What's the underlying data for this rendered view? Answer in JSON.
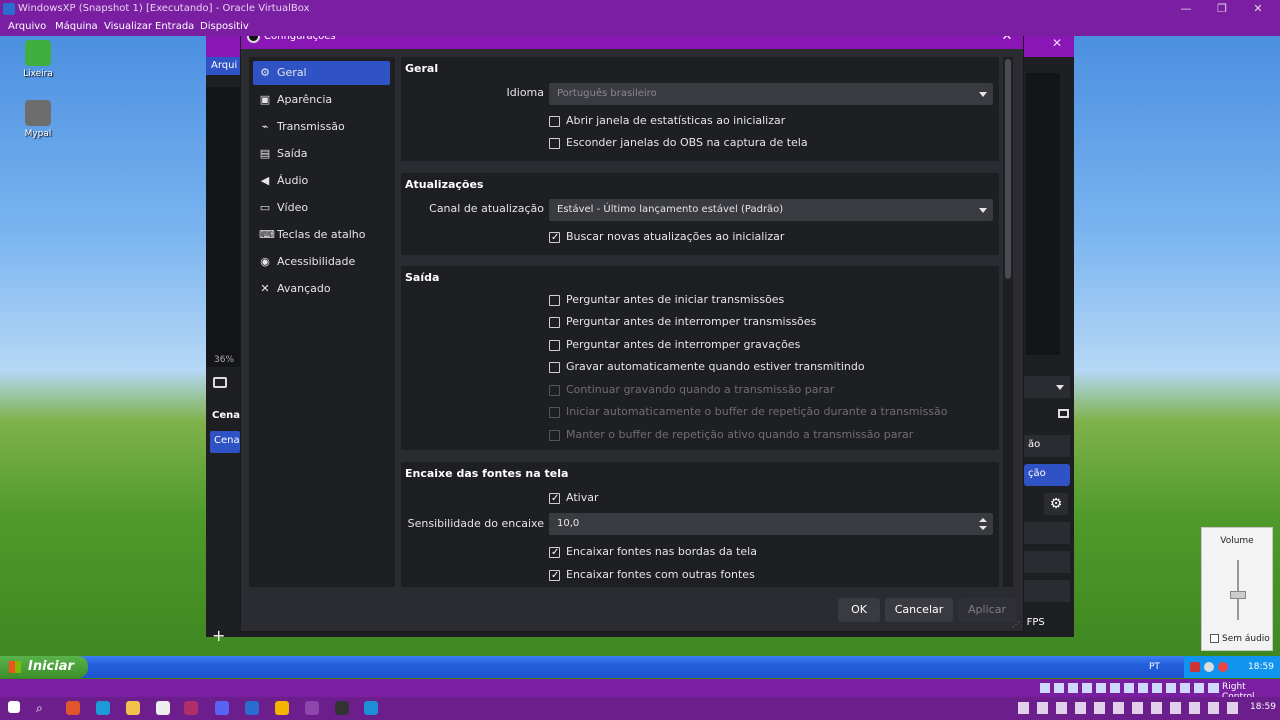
{
  "vbox": {
    "title": "WindowsXP (Snapshot 1) [Executando] - Oracle VirtualBox",
    "menu": [
      "Arquivo",
      "Máquina",
      "Visualizar",
      "Entrada",
      "Dispositiv"
    ],
    "status_hostkey": "Right Control"
  },
  "desktop": {
    "icons": [
      {
        "label": "Lixeira"
      },
      {
        "label": "Mypal"
      }
    ]
  },
  "obs_main": {
    "menu_partial": "Arqui",
    "zoom": "36%",
    "scenes_header": "Cena",
    "scene_item": "Cena",
    "fps": "FPS",
    "right_partial_1": "ão",
    "right_partial_2": "ção"
  },
  "settings": {
    "title": "Configurações",
    "nav": [
      {
        "label": "Geral",
        "icon": "gear-icon"
      },
      {
        "label": "Aparência",
        "icon": "appearance-icon"
      },
      {
        "label": "Transmissão",
        "icon": "antenna-icon"
      },
      {
        "label": "Saída",
        "icon": "output-icon"
      },
      {
        "label": "Áudio",
        "icon": "speaker-icon"
      },
      {
        "label": "Vídeo",
        "icon": "monitor-icon"
      },
      {
        "label": "Teclas de atalho",
        "icon": "keyboard-icon"
      },
      {
        "label": "Acessibilidade",
        "icon": "accessibility-icon"
      },
      {
        "label": "Avançado",
        "icon": "tools-icon"
      }
    ],
    "geral": {
      "title": "Geral",
      "idioma_label": "Idioma",
      "idioma_value": "Português brasileiro",
      "cb1": "Abrir janela de estatísticas ao inicializar",
      "cb2": "Esconder janelas do OBS na captura de tela"
    },
    "atualizacoes": {
      "title": "Atualizações",
      "canal_label": "Canal de atualização",
      "canal_value": "Estável - Último lançamento estável (Padrão)",
      "cb1": "Buscar novas atualizações ao inicializar"
    },
    "saida": {
      "title": "Saída",
      "cb1": "Perguntar antes de iniciar transmissões",
      "cb2": "Perguntar antes de interromper transmissões",
      "cb3": "Perguntar antes de interromper gravações",
      "cb4": "Gravar automaticamente quando estiver transmitindo",
      "cb5": "Continuar gravando quando a transmissão parar",
      "cb6": "Iniciar automaticamente o buffer de repetição durante a transmissão",
      "cb7": "Manter o buffer de repetição ativo quando a transmissão parar"
    },
    "encaixe": {
      "title": "Encaixe das fontes na tela",
      "cb1": "Ativar",
      "sens_label": "Sensibilidade do encaixe",
      "sens_value": "10,0",
      "cb2": "Encaixar fontes nas bordas da tela",
      "cb3": "Encaixar fontes com outras fontes"
    },
    "buttons": {
      "ok": "OK",
      "cancel": "Cancelar",
      "apply": "Aplicar"
    }
  },
  "volume": {
    "title": "Volume",
    "mute": "Sem áudio",
    "level": 0.4
  },
  "xp_taskbar": {
    "start": "Iniciar",
    "lang": "PT",
    "clock": "18:59"
  },
  "host_taskbar": {
    "clock": "18:59"
  }
}
